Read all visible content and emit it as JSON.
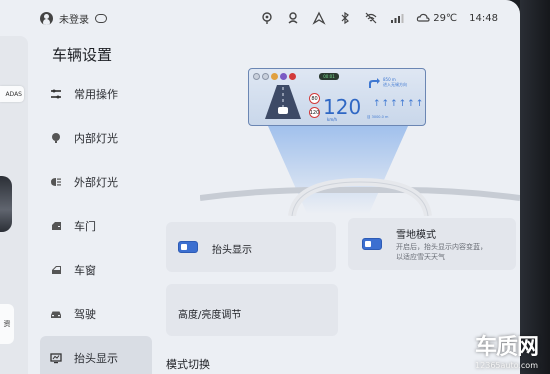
{
  "status": {
    "user": "未登录",
    "temperature": "29℃",
    "time": "14:48"
  },
  "left_strip": {
    "adas_label": "ADAS",
    "card_text": "资"
  },
  "page_title": "车辆设置",
  "nav": [
    {
      "label": "常用操作",
      "icon": "sliders-icon"
    },
    {
      "label": "内部灯光",
      "icon": "interior-light-icon"
    },
    {
      "label": "外部灯光",
      "icon": "headlight-icon"
    },
    {
      "label": "车门",
      "icon": "door-icon"
    },
    {
      "label": "车窗",
      "icon": "window-icon"
    },
    {
      "label": "驾驶",
      "icon": "car-icon"
    },
    {
      "label": "抬头显示",
      "icon": "hud-icon",
      "active": true
    }
  ],
  "hud_preview": {
    "speed": "120",
    "unit": "km/h",
    "pill": "00:01",
    "limit_1": "80",
    "limit_2": "120",
    "nav_line_1": "850 m",
    "nav_line_2": "进入无锡方向",
    "lane_text": "↑↑↑↑↑↑",
    "footer": "目 3000.0 m"
  },
  "hud_toggle": {
    "label": "抬头显示",
    "on": true
  },
  "snow_mode": {
    "label": "雪地模式",
    "description_line1": "开启后，抬头显示内容变蓝，",
    "description_line2": "以适应雪天天气",
    "on": true
  },
  "brightness": {
    "label": "高度/亮度调节"
  },
  "mode_section_title": "模式切换",
  "watermark": {
    "main": "车质网",
    "sub": "12365auto.com"
  },
  "colors": {
    "accent": "#3c6fd0",
    "background": "#eceff4",
    "card": "#e3e6ec"
  }
}
